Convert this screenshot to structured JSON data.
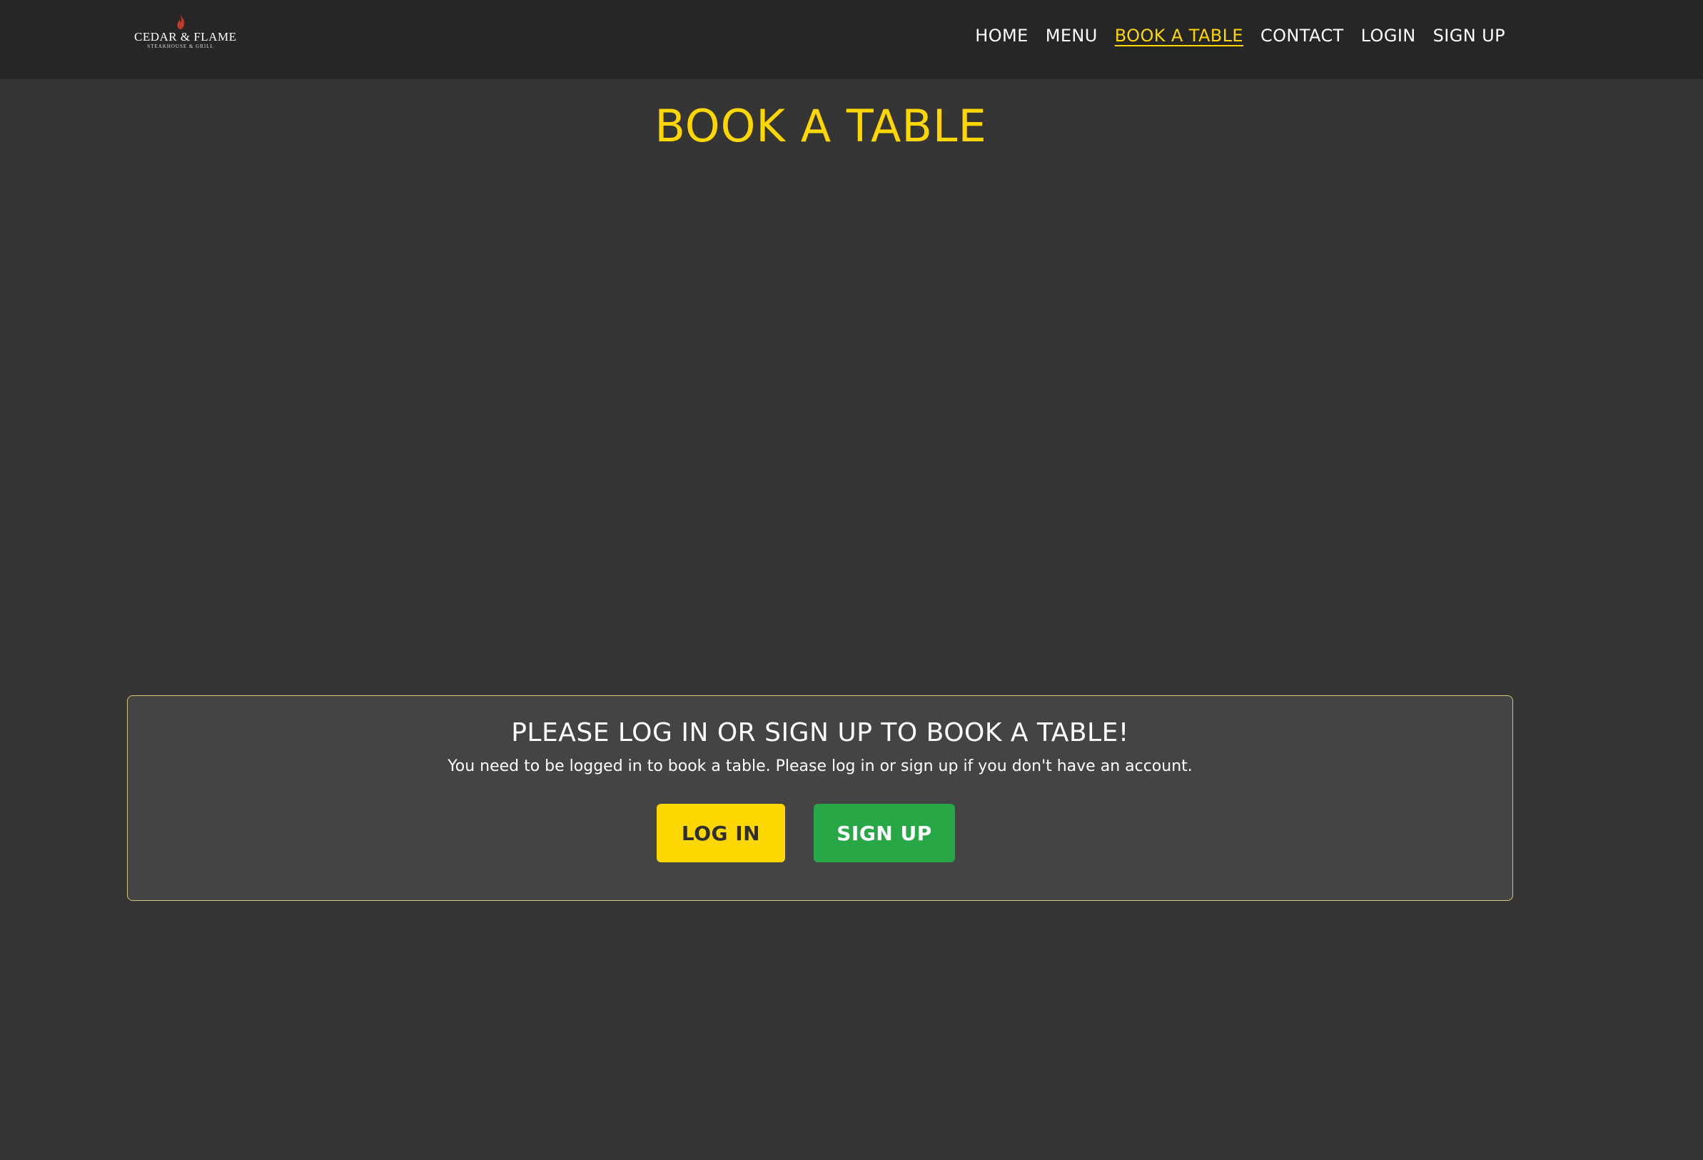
{
  "brand": {
    "name": "CEDAR & FLAME",
    "tagline": "STEAKHOUSE & GRILL"
  },
  "nav": {
    "items": [
      {
        "label": "HOME"
      },
      {
        "label": "MENU"
      },
      {
        "label": "BOOK A TABLE",
        "active": true
      },
      {
        "label": "CONTACT"
      },
      {
        "label": "LOGIN"
      },
      {
        "label": "SIGN UP"
      }
    ]
  },
  "page": {
    "title": "BOOK A TABLE"
  },
  "notice": {
    "heading": "PLEASE LOG IN OR SIGN UP TO BOOK A TABLE!",
    "message": "You need to be logged in to book a table. Please log in or sign up if you don't have an account.",
    "login_label": "LOG IN",
    "signup_label": "SIGN UP"
  },
  "colors": {
    "accent": "#ffd700",
    "success": "#27a745",
    "navbar_bg": "#262626",
    "page_bg": "#353535",
    "card_bg": "#444444",
    "card_border": "#d8c47a",
    "flame": "#c0392b"
  },
  "icons": {
    "logo_flame": "flame-icon"
  }
}
